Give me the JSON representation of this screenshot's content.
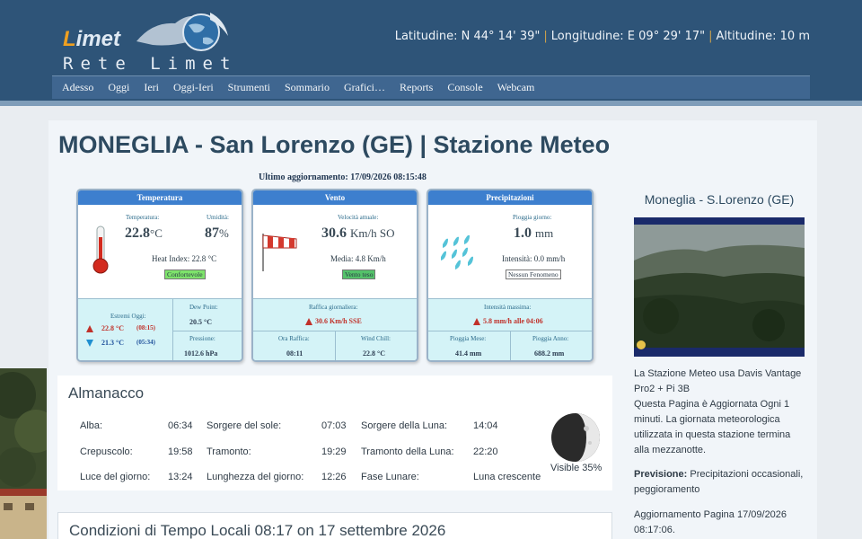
{
  "header": {
    "logo_first": "L",
    "logo_rest": "imet",
    "logo_sub": "Rete Limet",
    "latitude": "Latitudine: N 44° 14' 39\"",
    "longitude": "Longitudine: E 09° 29' 17\"",
    "altitude": "Altitudine: 10 m",
    "separator": "|"
  },
  "nav": [
    "Adesso",
    "Oggi",
    "Ieri",
    "Oggi-Ieri",
    "Strumenti",
    "Sommario",
    "Grafici…",
    "Reports",
    "Console",
    "Webcam"
  ],
  "page": {
    "title": "MONEGLIA - San Lorenzo (GE) | Stazione Meteo",
    "last_update": "Ultimo aggiornamento: 17/09/2026 08:15:48"
  },
  "temperature": {
    "heading": "Temperatura",
    "temp_label": "Temperatura:",
    "temp_value": "22.8",
    "temp_unit": "°C",
    "humidity_label": "Umidità:",
    "humidity_value": "87",
    "humidity_unit": "%",
    "heat_index": "Heat Index: 22.8 °C",
    "comfort": "Confortevole",
    "extremes_label": "Estremi Oggi:",
    "max_value": "22.8 °C",
    "max_time": "(08:15)",
    "min_value": "21.3 °C",
    "min_time": "(05:34)",
    "dewpoint_label": "Dew Point:",
    "dewpoint_value": "20.5 °C",
    "pressure_label": "Pressione:",
    "pressure_value": "1012.6 hPa"
  },
  "wind": {
    "heading": "Vento",
    "speed_label": "Velocità attuale:",
    "speed_value": "30.6",
    "speed_unit": "Km/h SO",
    "avg": "Media: 4.8 Km/h",
    "description": "Vento teso",
    "gust_label": "Raffica giornaliera:",
    "gust_value": "30.6 Km/h SSE",
    "gust_time_label": "Ora Raffica:",
    "gust_time_value": "08:11",
    "windchill_label": "Wind Chill:",
    "windchill_value": "22.8 °C"
  },
  "rain": {
    "heading": "Precipitazioni",
    "daily_label": "Pioggia giorno:",
    "daily_value": "1.0",
    "daily_unit": "mm",
    "intensity": "Intensità: 0.0 mm/h",
    "phenomenon": "Nessun Fenomeno",
    "max_intensity_label": "Intensità massima:",
    "max_intensity_value": "5.8 mm/h alle 04:06",
    "month_label": "Pioggia Mese:",
    "month_value": "41.4 mm",
    "year_label": "Pioggia Anno:",
    "year_value": "688.2 mm"
  },
  "almanac": {
    "title": "Almanacco",
    "rows": [
      [
        "Alba:",
        "06:34",
        "Sorgere del sole:",
        "07:03",
        "Sorgere della Luna:",
        "14:04"
      ],
      [
        "Crepuscolo:",
        "19:58",
        "Tramonto:",
        "19:29",
        "Tramonto della Luna:",
        "22:20"
      ],
      [
        "Luce del giorno:",
        "13:24",
        "Lunghezza del giorno:",
        "12:26",
        "Fase Lunare:",
        "Luna crescente"
      ]
    ],
    "moon_visible": "Visible 35%",
    "moon_visible_fraction": 0.35
  },
  "conditions": {
    "title": "Condizioni di Tempo Locali 08:17 on 17 settembre 2026"
  },
  "sidebar": {
    "title": "Moneglia - S.Lorenzo (GE)",
    "station_info": "La Stazione Meteo usa Davis Vantage Pro2 + Pi 3B",
    "refresh_info": "Questa Pagina è Aggiornata Ogni 1 minuti. La giornata meteorologica utilizzata in questa stazione termina alla mezzanotte.",
    "forecast_label": "Previsione:",
    "forecast_text": "Precipitazioni occasionali, peggioramento",
    "page_update_label": "Aggiornamento Pagina",
    "page_update_value": "17/09/2026 08:17:06."
  },
  "colors": {
    "header_bg": "#2e5478",
    "nav_bg": "#3f6690",
    "panel_head": "#3d7fce",
    "panel_bottom": "#d4f3f7",
    "badge_green": "#7ee36b",
    "alert_red": "#c0312a"
  }
}
